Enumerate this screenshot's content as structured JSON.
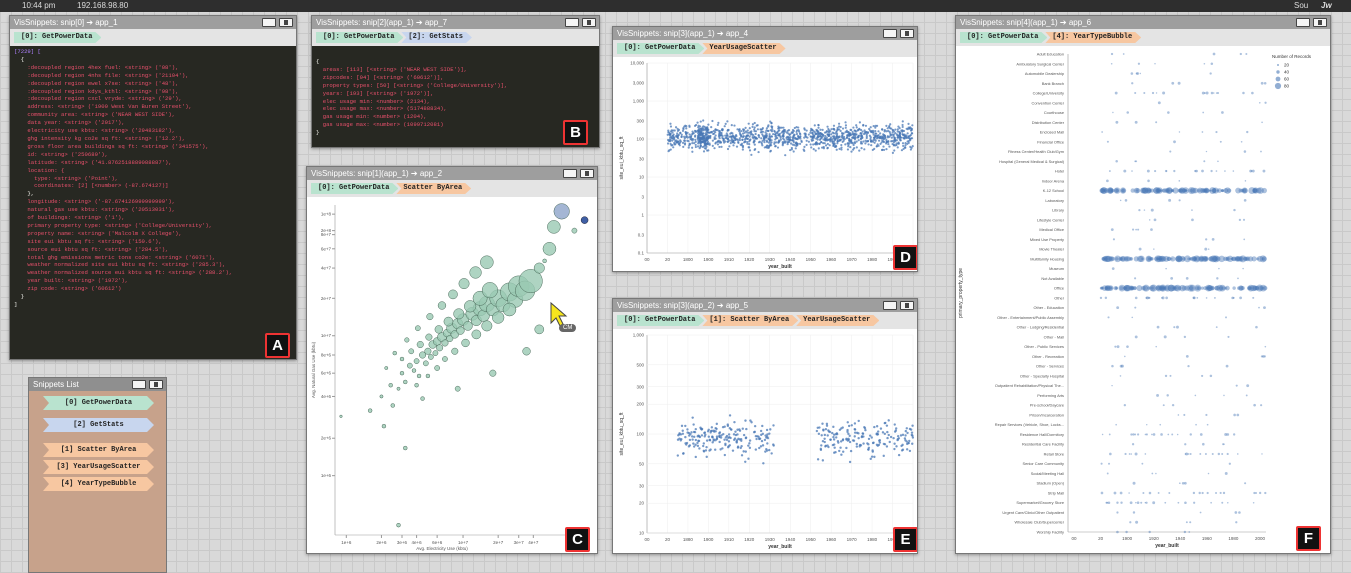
{
  "status_bar": {
    "time": "10:44 pm",
    "ip": "192.168.98.80",
    "user": "Sou",
    "app": "Jw"
  },
  "colors": {
    "green_chip": "#b9e3cf",
    "blue_chip": "#c8d6ee",
    "orange_chip": "#f7c7a1",
    "code_bg": "#272822",
    "badge_border": "#e33333",
    "scatter_point": "#4a78b5",
    "bubble_green": "#9ac9b3"
  },
  "windows": {
    "A": {
      "title": "VisSnippets: snip[0] ➔ app_1",
      "chips": [
        "[0]: GetPowerData"
      ],
      "badge": "A",
      "code": [
        {
          "t": "[7229] [",
          "c": "n"
        },
        {
          "t": "  {",
          "c": ""
        },
        {
          "t": "    :decoupled region 4hex fuel: <string> ('08'),",
          "c": "k"
        },
        {
          "t": "    :decoupled region 4nhs file: <string> ('21104'),",
          "c": "k"
        },
        {
          "t": "    :decoupled region ewel x7se: <string> ('48'),",
          "c": "k"
        },
        {
          "t": "    :decoupled region kdys_kthl: <string> ('98'),",
          "c": "k"
        },
        {
          "t": "    :decoupled region cxcl vryde: <string> ('29'),",
          "c": "k"
        },
        {
          "t": "    address: <string> ('1900 West Van Buren Street'),",
          "c": "k"
        },
        {
          "t": "    community area: <string> ('NEAR WEST SIDE'),",
          "c": "k"
        },
        {
          "t": "    data year: <string> ('2017'),",
          "c": "k"
        },
        {
          "t": "    electricity use kbtu: <string> ('29483182'),",
          "c": "k"
        },
        {
          "t": "    ghg intensity kg co2e sq ft: <string> ('12.2'),",
          "c": "k"
        },
        {
          "t": "    gross floor area buildings sq ft: <string> ('341575'),",
          "c": "k"
        },
        {
          "t": "    id: <string> ('250689'),",
          "c": "k"
        },
        {
          "t": "    latitude: <string> ('41.8762518889088887'),",
          "c": "k"
        },
        {
          "t": "    location: {",
          "c": "k"
        },
        {
          "t": "      type: <string> ('Point'),",
          "c": "k"
        },
        {
          "t": "      coordinates: [2] [<number> (-87.674127)]",
          "c": "k"
        },
        {
          "t": "    },",
          "c": ""
        },
        {
          "t": "    longitude: <string> ('-87.674126999999999'),",
          "c": "k"
        },
        {
          "t": "    natural gas use kbtu: <string> ('20513031'),",
          "c": "k"
        },
        {
          "t": "    of buildings: <string> ('1'),",
          "c": "k"
        },
        {
          "t": "    primary property type: <string> ('College/University'),",
          "c": "k"
        },
        {
          "t": "    property name: <string> ('Malcolm X College'),",
          "c": "k"
        },
        {
          "t": "    site eui kbtu sq ft: <string> ('150.6'),",
          "c": "k"
        },
        {
          "t": "    source eui kbtu sq ft: <string> ('284.5'),",
          "c": "k"
        },
        {
          "t": "    total ghg emissions metric tons co2e: <string> ('6071'),",
          "c": "k"
        },
        {
          "t": "    weather normalized site eui kbtu sq ft: <string> ('285.3'),",
          "c": "k"
        },
        {
          "t": "    weather normalized source eui kbtu sq ft: <string> ('288.2'),",
          "c": "k"
        },
        {
          "t": "    year built: <string> ('1972'),",
          "c": "k"
        },
        {
          "t": "    zip code: <string> ('60612')",
          "c": "k"
        },
        {
          "t": "  }",
          "c": ""
        },
        {
          "t": "]",
          "c": ""
        }
      ]
    },
    "B": {
      "title": "VisSnippets: snip[2](app_1) ➔ app_7",
      "chips": [
        "[0]: GetPowerData",
        "[2]: GetStats"
      ],
      "badge": "B",
      "code": [
        {
          "t": "{",
          "c": ""
        },
        {
          "t": "  areas: [113] [<string> ('NEAR WEST SIDE')],",
          "c": "k"
        },
        {
          "t": "  zipcodes: [94] [<string> ('60612')],",
          "c": "k"
        },
        {
          "t": "  property types: [50] [<string> ('College/University')],",
          "c": "k"
        },
        {
          "t": "  years: [193] [<string> ('1972')],",
          "c": "k"
        },
        {
          "t": "  elec usage min: <number> (2134),",
          "c": "k"
        },
        {
          "t": "  elec usage max: <number> (517488834),",
          "c": "k"
        },
        {
          "t": "  gas usage min: <number> (1204),",
          "c": "k"
        },
        {
          "t": "  gas usage max: <number> (1099712081)",
          "c": "k"
        },
        {
          "t": "}",
          "c": ""
        }
      ]
    },
    "C": {
      "title": "VisSnippets: snip[1](app_1) ➔ app_2",
      "chips": [
        "[0]: GetPowerData",
        "Scatter ByArea"
      ],
      "badge": "C",
      "cursor_label": "CM"
    },
    "D": {
      "title": "VisSnippets: snip[3](app_1) ➔ app_4",
      "chips": [
        "[0]: GetPowerData",
        "YearUsageScatter"
      ],
      "badge": "D"
    },
    "E": {
      "title": "VisSnippets: snip[3](app_2) ➔ app_5",
      "chips": [
        "[0]: GetPowerData",
        "[1]: Scatter ByArea",
        "YearUsageScatter"
      ],
      "badge": "E"
    },
    "F": {
      "title": "VisSnippets: snip[4](app_1) ➔ app_6",
      "chips": [
        "[0]: GetPowerData",
        "[4]: YearTypeBubble"
      ],
      "badge": "F"
    }
  },
  "snippets_list": {
    "title": "Snippets List",
    "items": [
      {
        "label": "[0] GetPowerData",
        "color": "green"
      },
      {
        "label": "[2] GetStats",
        "color": "blue"
      },
      {
        "label": "[1] Scatter ByArea",
        "color": "orange"
      },
      {
        "label": "[3] YearUsageScatter",
        "color": "orange"
      },
      {
        "label": "[4] YearTypeBubble",
        "color": "orange"
      }
    ]
  },
  "chart_data": [
    {
      "id": "C",
      "type": "scatter",
      "title": "",
      "xlabel": "Avg. Electricity Use (kbtu)",
      "ylabel": "Avg. Natural Gas Use (kbtu)",
      "xscale": "log",
      "yscale": "log",
      "xticks": [
        "1e+6",
        "2e+6",
        "3e+6",
        "4e+6",
        "6e+6",
        "1e+7",
        "2e+7",
        "3e+7",
        "4e+7"
      ],
      "yticks": [
        "1e+8",
        "2e+8",
        "8e+7",
        "6e+7",
        "4e+7",
        "2e+7",
        "1e+7",
        "8e+6",
        "6e+6",
        "4e+6",
        "2e+6",
        "1e+6"
      ],
      "points": [
        {
          "x": 2,
          "y": 1.3,
          "r": 2.5
        },
        {
          "x": 2.4,
          "y": 1.6,
          "r": 3
        },
        {
          "x": 2.8,
          "y": 1.5,
          "r": 2.5
        },
        {
          "x": 3,
          "y": 2,
          "r": 3
        },
        {
          "x": 3.2,
          "y": 1.7,
          "r": 3
        },
        {
          "x": 3.5,
          "y": 2.3,
          "r": 4
        },
        {
          "x": 3.8,
          "y": 2.1,
          "r": 3
        },
        {
          "x": 4,
          "y": 2.5,
          "r": 4
        },
        {
          "x": 4.2,
          "y": 1.9,
          "r": 3
        },
        {
          "x": 4.5,
          "y": 2.8,
          "r": 5
        },
        {
          "x": 4.8,
          "y": 2.4,
          "r": 4
        },
        {
          "x": 5,
          "y": 3,
          "r": 5
        },
        {
          "x": 5.3,
          "y": 2.7,
          "r": 4
        },
        {
          "x": 5.5,
          "y": 3.4,
          "r": 6
        },
        {
          "x": 5.8,
          "y": 2.9,
          "r": 4
        },
        {
          "x": 6,
          "y": 3.6,
          "r": 6
        },
        {
          "x": 6.3,
          "y": 3.2,
          "r": 5
        },
        {
          "x": 6.6,
          "y": 3.9,
          "r": 7
        },
        {
          "x": 7,
          "y": 3.5,
          "r": 5
        },
        {
          "x": 7.3,
          "y": 4.2,
          "r": 6
        },
        {
          "x": 7.7,
          "y": 3.8,
          "r": 5
        },
        {
          "x": 8,
          "y": 4.6,
          "r": 8
        },
        {
          "x": 8.5,
          "y": 4.1,
          "r": 6
        },
        {
          "x": 9,
          "y": 5,
          "r": 8
        },
        {
          "x": 9.5,
          "y": 4.4,
          "r": 6
        },
        {
          "x": 10,
          "y": 5.4,
          "r": 9
        },
        {
          "x": 11,
          "y": 4.8,
          "r": 7
        },
        {
          "x": 12,
          "y": 6,
          "r": 10
        },
        {
          "x": 13,
          "y": 5.3,
          "r": 8
        },
        {
          "x": 14,
          "y": 6.6,
          "r": 11
        },
        {
          "x": 15,
          "y": 5.8,
          "r": 9
        },
        {
          "x": 16,
          "y": 7.2,
          "r": 12
        },
        {
          "x": 18,
          "y": 6.5,
          "r": 10
        },
        {
          "x": 20,
          "y": 8,
          "r": 13
        },
        {
          "x": 22,
          "y": 7.1,
          "r": 11
        },
        {
          "x": 25,
          "y": 9,
          "r": 14
        },
        {
          "x": 28,
          "y": 7.8,
          "r": 12
        },
        {
          "x": 30,
          "y": 10,
          "r": 16
        },
        {
          "x": 34,
          "y": 9.2,
          "r": 15
        },
        {
          "x": 38,
          "y": 11,
          "r": 18
        },
        {
          "x": 3,
          "y": 2.6,
          "r": 3
        },
        {
          "x": 3.6,
          "y": 3,
          "r": 4
        },
        {
          "x": 4.3,
          "y": 3.4,
          "r": 5
        },
        {
          "x": 5.1,
          "y": 3.9,
          "r": 5
        },
        {
          "x": 6.2,
          "y": 4.5,
          "r": 6
        },
        {
          "x": 7.5,
          "y": 5.2,
          "r": 7
        },
        {
          "x": 9.2,
          "y": 6,
          "r": 8
        },
        {
          "x": 11.5,
          "y": 6.9,
          "r": 9
        },
        {
          "x": 14,
          "y": 8,
          "r": 11
        },
        {
          "x": 17,
          "y": 9.3,
          "r": 12
        },
        {
          "x": 4,
          "y": 1.6,
          "r": 3
        },
        {
          "x": 5,
          "y": 1.9,
          "r": 3
        },
        {
          "x": 6,
          "y": 2.2,
          "r": 4
        },
        {
          "x": 7,
          "y": 2.6,
          "r": 4
        },
        {
          "x": 8.5,
          "y": 3,
          "r": 5
        },
        {
          "x": 10.5,
          "y": 3.5,
          "r": 6
        },
        {
          "x": 13,
          "y": 4.1,
          "r": 7
        },
        {
          "x": 16,
          "y": 4.8,
          "r": 8
        },
        {
          "x": 20,
          "y": 5.6,
          "r": 9
        },
        {
          "x": 25,
          "y": 6.5,
          "r": 10
        },
        {
          "x": 2.2,
          "y": 2.2,
          "r": 2.5
        },
        {
          "x": 2.6,
          "y": 2.9,
          "r": 3
        },
        {
          "x": 3.3,
          "y": 3.7,
          "r": 3.5
        },
        {
          "x": 4.1,
          "y": 4.6,
          "r": 4
        },
        {
          "x": 5.2,
          "y": 5.7,
          "r": 5
        },
        {
          "x": 6.6,
          "y": 7,
          "r": 6
        },
        {
          "x": 8.2,
          "y": 8.6,
          "r": 7
        },
        {
          "x": 10.2,
          "y": 10.5,
          "r": 8
        },
        {
          "x": 12.8,
          "y": 12.9,
          "r": 9
        },
        {
          "x": 16,
          "y": 15.6,
          "r": 10
        },
        {
          "x": 1.6,
          "y": 1.0,
          "r": 3
        },
        {
          "x": 2.5,
          "y": 1.1,
          "r": 3
        },
        {
          "x": 4.5,
          "y": 1.25,
          "r": 3
        },
        {
          "x": 9,
          "y": 1.5,
          "r": 4
        },
        {
          "x": 18,
          "y": 2,
          "r": 5
        },
        {
          "x": 35,
          "y": 3,
          "r": 6
        },
        {
          "x": 45,
          "y": 4.5,
          "r": 7
        },
        {
          "x": 50,
          "y": 16,
          "r": 3
        },
        {
          "x": 45,
          "y": 14,
          "r": 8
        },
        {
          "x": 55,
          "y": 20,
          "r": 10
        },
        {
          "x": 60,
          "y": 30,
          "r": 10
        },
        {
          "x": 90,
          "y": 28,
          "r": 4
        },
        {
          "x": 70,
          "y": 40,
          "r": 12
        },
        {
          "x": 2.1,
          "y": 0.75,
          "r": 3
        },
        {
          "x": 0.9,
          "y": 0.9,
          "r": 2
        },
        {
          "x": 3.2,
          "y": 0.5,
          "r": 3
        },
        {
          "x": 2.8,
          "y": 0.12,
          "r": 3
        }
      ]
    },
    {
      "id": "D",
      "type": "scatter",
      "xlabel": "year_built",
      "ylabel": "site_eui_kbtu_sq_ft",
      "yscale": "log",
      "xticks": [
        "00",
        "20",
        "1800",
        "1900",
        "1910",
        "1920",
        "1930",
        "1940",
        "1950",
        "1960",
        "1970",
        "1980",
        "1990",
        "2000"
      ],
      "yticks": [
        "10,000",
        "3,000",
        "1,000",
        "300",
        "100",
        "30",
        "10",
        "3",
        "1",
        "0.3",
        "0.1"
      ]
    },
    {
      "id": "E",
      "type": "scatter",
      "xlabel": "year_built",
      "ylabel": "site_eui_kbtu_sq_ft",
      "yscale": "log",
      "xticks": [
        "00",
        "20",
        "1880",
        "1900",
        "1910",
        "1920",
        "1930",
        "1940",
        "1950",
        "1960",
        "1970",
        "1980",
        "1990",
        "2000"
      ],
      "yticks": [
        "1,000",
        "500",
        "300",
        "200",
        "100",
        "50",
        "30",
        "20",
        "10"
      ]
    },
    {
      "id": "F",
      "type": "scatter",
      "xlabel": "year_built",
      "ylabel": "primary_property_type",
      "legend_title": "Number of Records",
      "legend": [
        "20",
        "40",
        "60",
        "80"
      ],
      "xticks": [
        "00",
        "20",
        "1900",
        "1920",
        "1940",
        "1960",
        "1980",
        "2000"
      ],
      "categories": [
        "Adult Education",
        "Ambulatory Surgical Center",
        "Automobile Dealership",
        "Bank Branch",
        "College/University",
        "Convention Center",
        "Courthouse",
        "Distribution Center",
        "Enclosed Mall",
        "Financial Office",
        "Fitness Center/Health Club/Gym",
        "Hospital (General Medical & Surgical)",
        "Hotel",
        "Indoor Arena",
        "K-12 School",
        "Laboratory",
        "Library",
        "Lifestyle Center",
        "Medical Office",
        "Mixed Use Property",
        "Movie Theater",
        "Multifamily Housing",
        "Museum",
        "Not Available",
        "Office",
        "Other",
        "Other - Education",
        "Other - Entertainment/Public Assembly",
        "Other - Lodging/Residential",
        "Other - Mall",
        "Other - Public Services",
        "Other - Recreation",
        "Other - Services",
        "Other - Specialty Hospital",
        "Outpatient Rehabilitation/Physical The...",
        "Performing Arts",
        "Pre-school/Daycare",
        "Prison/Incarceration",
        "Repair Services (Vehicle, Shoe, Locks...",
        "Residence Hall/Dormitory",
        "Residential Care Facility",
        "Retail Store",
        "Senior Care Community",
        "Social/Meeting Hall",
        "Stadium (Open)",
        "Strip Mall",
        "Supermarket/Grocery Store",
        "Urgent Care/Clinic/Other Outpatient",
        "Wholesale Club/Supercenter",
        "Worship Facility"
      ]
    }
  ]
}
